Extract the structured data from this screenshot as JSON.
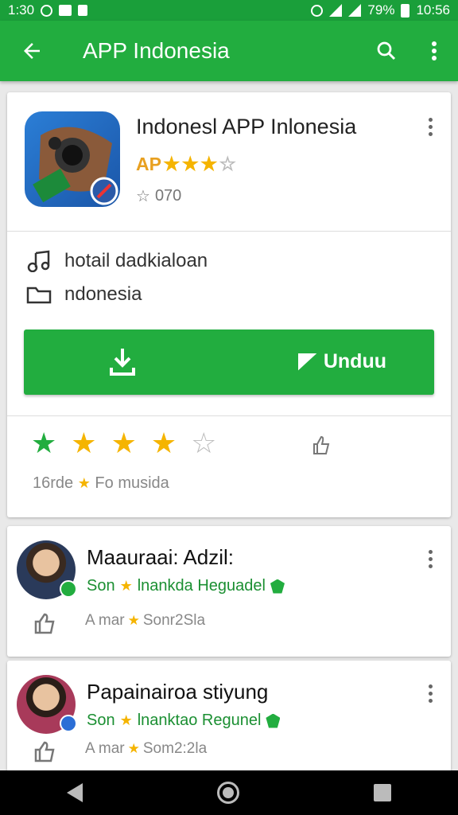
{
  "status_bar": {
    "time_left": "1:30",
    "battery": "79%",
    "time_right": "10:56"
  },
  "app_bar": {
    "title": "APP Indonesia"
  },
  "app_card": {
    "title": "Indonesl APP Inlonesia",
    "subtitle": "AP",
    "rating_stars": 4,
    "count": "070",
    "meta_music": "hotail  dadkialoan",
    "meta_folder": "ndonesia",
    "download_label": "Unduu",
    "rate_caption_left": "16rde",
    "rate_caption_right": "Fo musida",
    "user_rating": 4
  },
  "reviews": [
    {
      "name": "Maauraai: Adzil:",
      "sub_left": "Son",
      "sub_right": "lnankda Heguadel",
      "meta_left": "A mar",
      "meta_right": "Sonr2Sla"
    },
    {
      "name": "Papainairoa stiyung",
      "sub_left": "Son",
      "sub_right": "lnanktao Regunel",
      "meta_left": "A mar",
      "meta_right": "Som2:2la"
    }
  ],
  "colors": {
    "primary": "#22ad3f",
    "status": "#1a9f3a",
    "star": "#f5b400"
  }
}
